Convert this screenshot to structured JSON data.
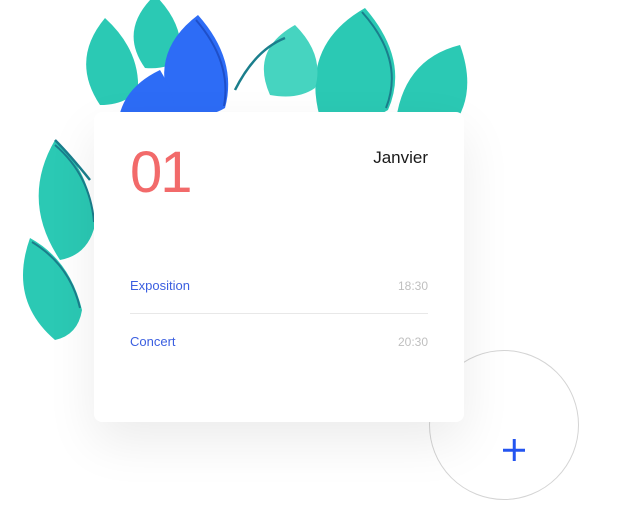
{
  "card": {
    "day": "01",
    "month": "Janvier"
  },
  "events": [
    {
      "title": "Exposition",
      "time": "18:30"
    },
    {
      "title": "Concert",
      "time": "20:30"
    }
  ],
  "colors": {
    "accent_red": "#F26A6A",
    "link_blue": "#3B5FE0",
    "plus_blue": "#2455F0",
    "leaf_teal": "#2BC9B4",
    "leaf_teal_dark": "#1A7E8C",
    "leaf_blue": "#2D6CF6",
    "leaf_blue_dark": "#1E4FC9"
  }
}
